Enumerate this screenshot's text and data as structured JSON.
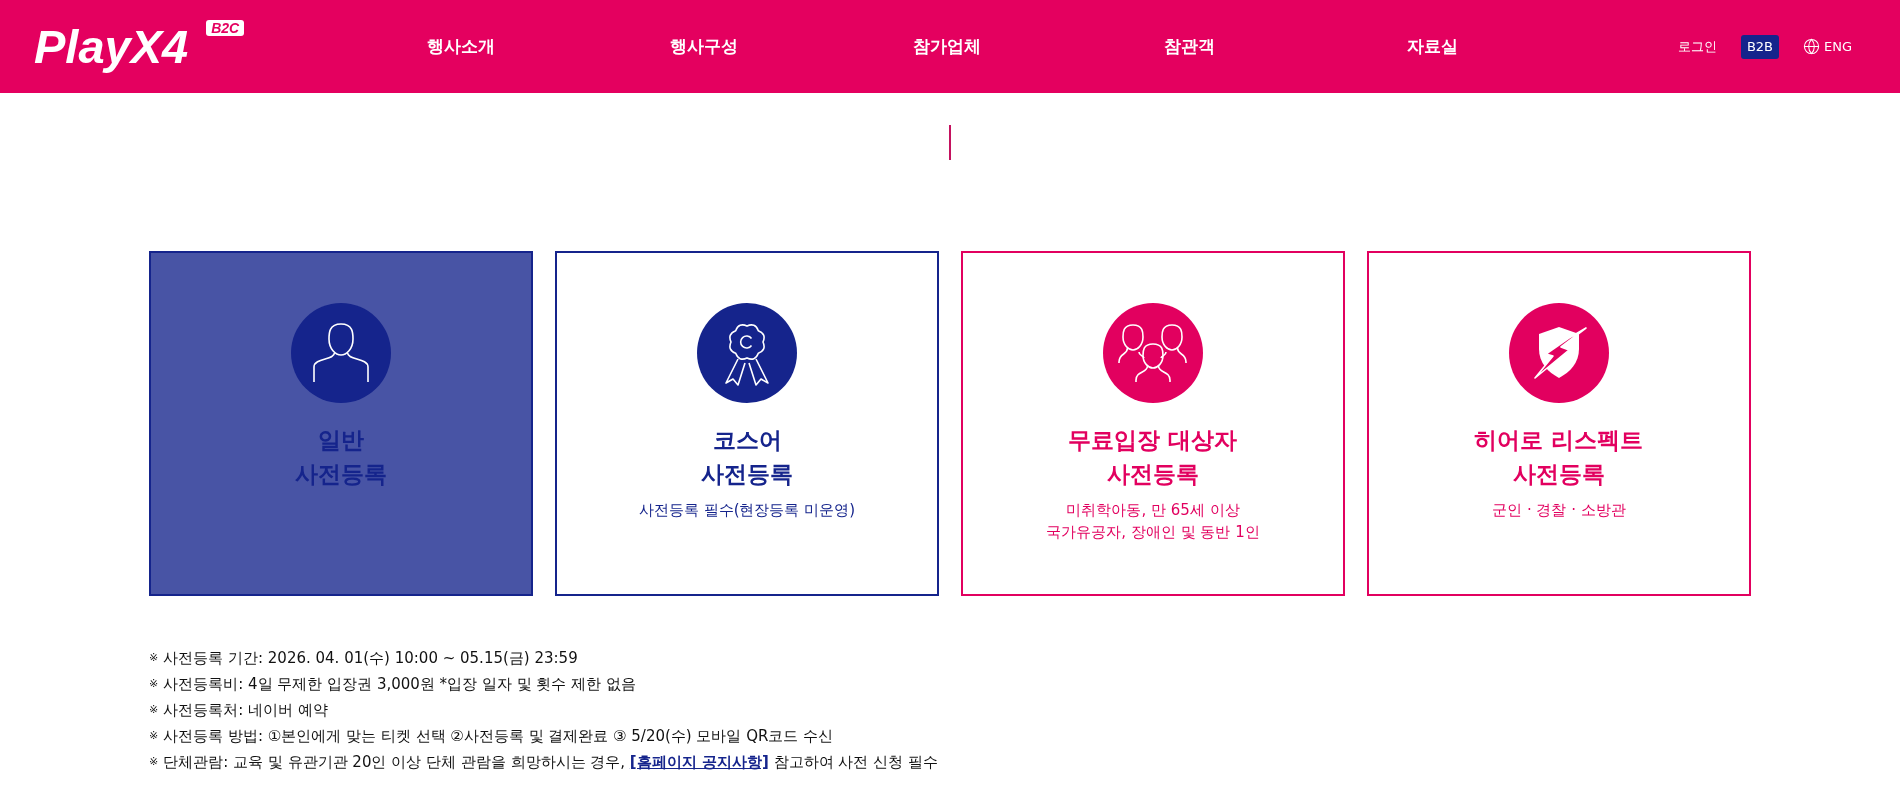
{
  "header": {
    "logo": {
      "text": "PlayX4",
      "badge": "B2C"
    },
    "nav": [
      "행사소개",
      "행사구성",
      "참가업체",
      "참관객",
      "자료실"
    ],
    "login": "로그인",
    "b2b": "B2B",
    "language": "ENG"
  },
  "cards": [
    {
      "title": "일반\n사전등록",
      "color": "#15248c",
      "selected": true
    },
    {
      "title": "코스어\n사전등록",
      "description": "사전등록 필수(현장등록 미운영)",
      "color": "#15248c",
      "selected": false
    },
    {
      "title": "무료입장 대상자\n사전등록",
      "description": "미취학아동, 만 65세 이상\n국가유공자, 장애인 및 동반 1인",
      "color": "#e2005f",
      "selected": false
    },
    {
      "title": "히어로 리스펙트\n사전등록",
      "description": "군인 · 경찰 · 소방관",
      "color": "#e2005f",
      "selected": false
    }
  ],
  "notes": [
    {
      "mark": "※",
      "text": "사전등록 기간: 2026. 04. 01(수) 10:00 ~ 05.15(금) 23:59"
    },
    {
      "mark": "※",
      "text": "사전등록비: 4일 무제한 입장권 3,000원 *입장 일자 및 횟수 제한 없음"
    },
    {
      "mark": "※",
      "text": "사전등록처: 네이버 예약"
    },
    {
      "mark": "※",
      "text": "사전등록 방법: ①본인에게 맞는 티켓 선택 ②사전등록 및 결제완료 ③ 5/20(수) 모바일 QR코드 수신"
    },
    {
      "mark": "※",
      "text": "단체관람: 교육 및 유관기관 20인 이상 단체 관람을 희망하시는 경우,",
      "link": "[홈페이지 공지사항]",
      "text_after": "참고하여 사전 신청 필수"
    }
  ]
}
